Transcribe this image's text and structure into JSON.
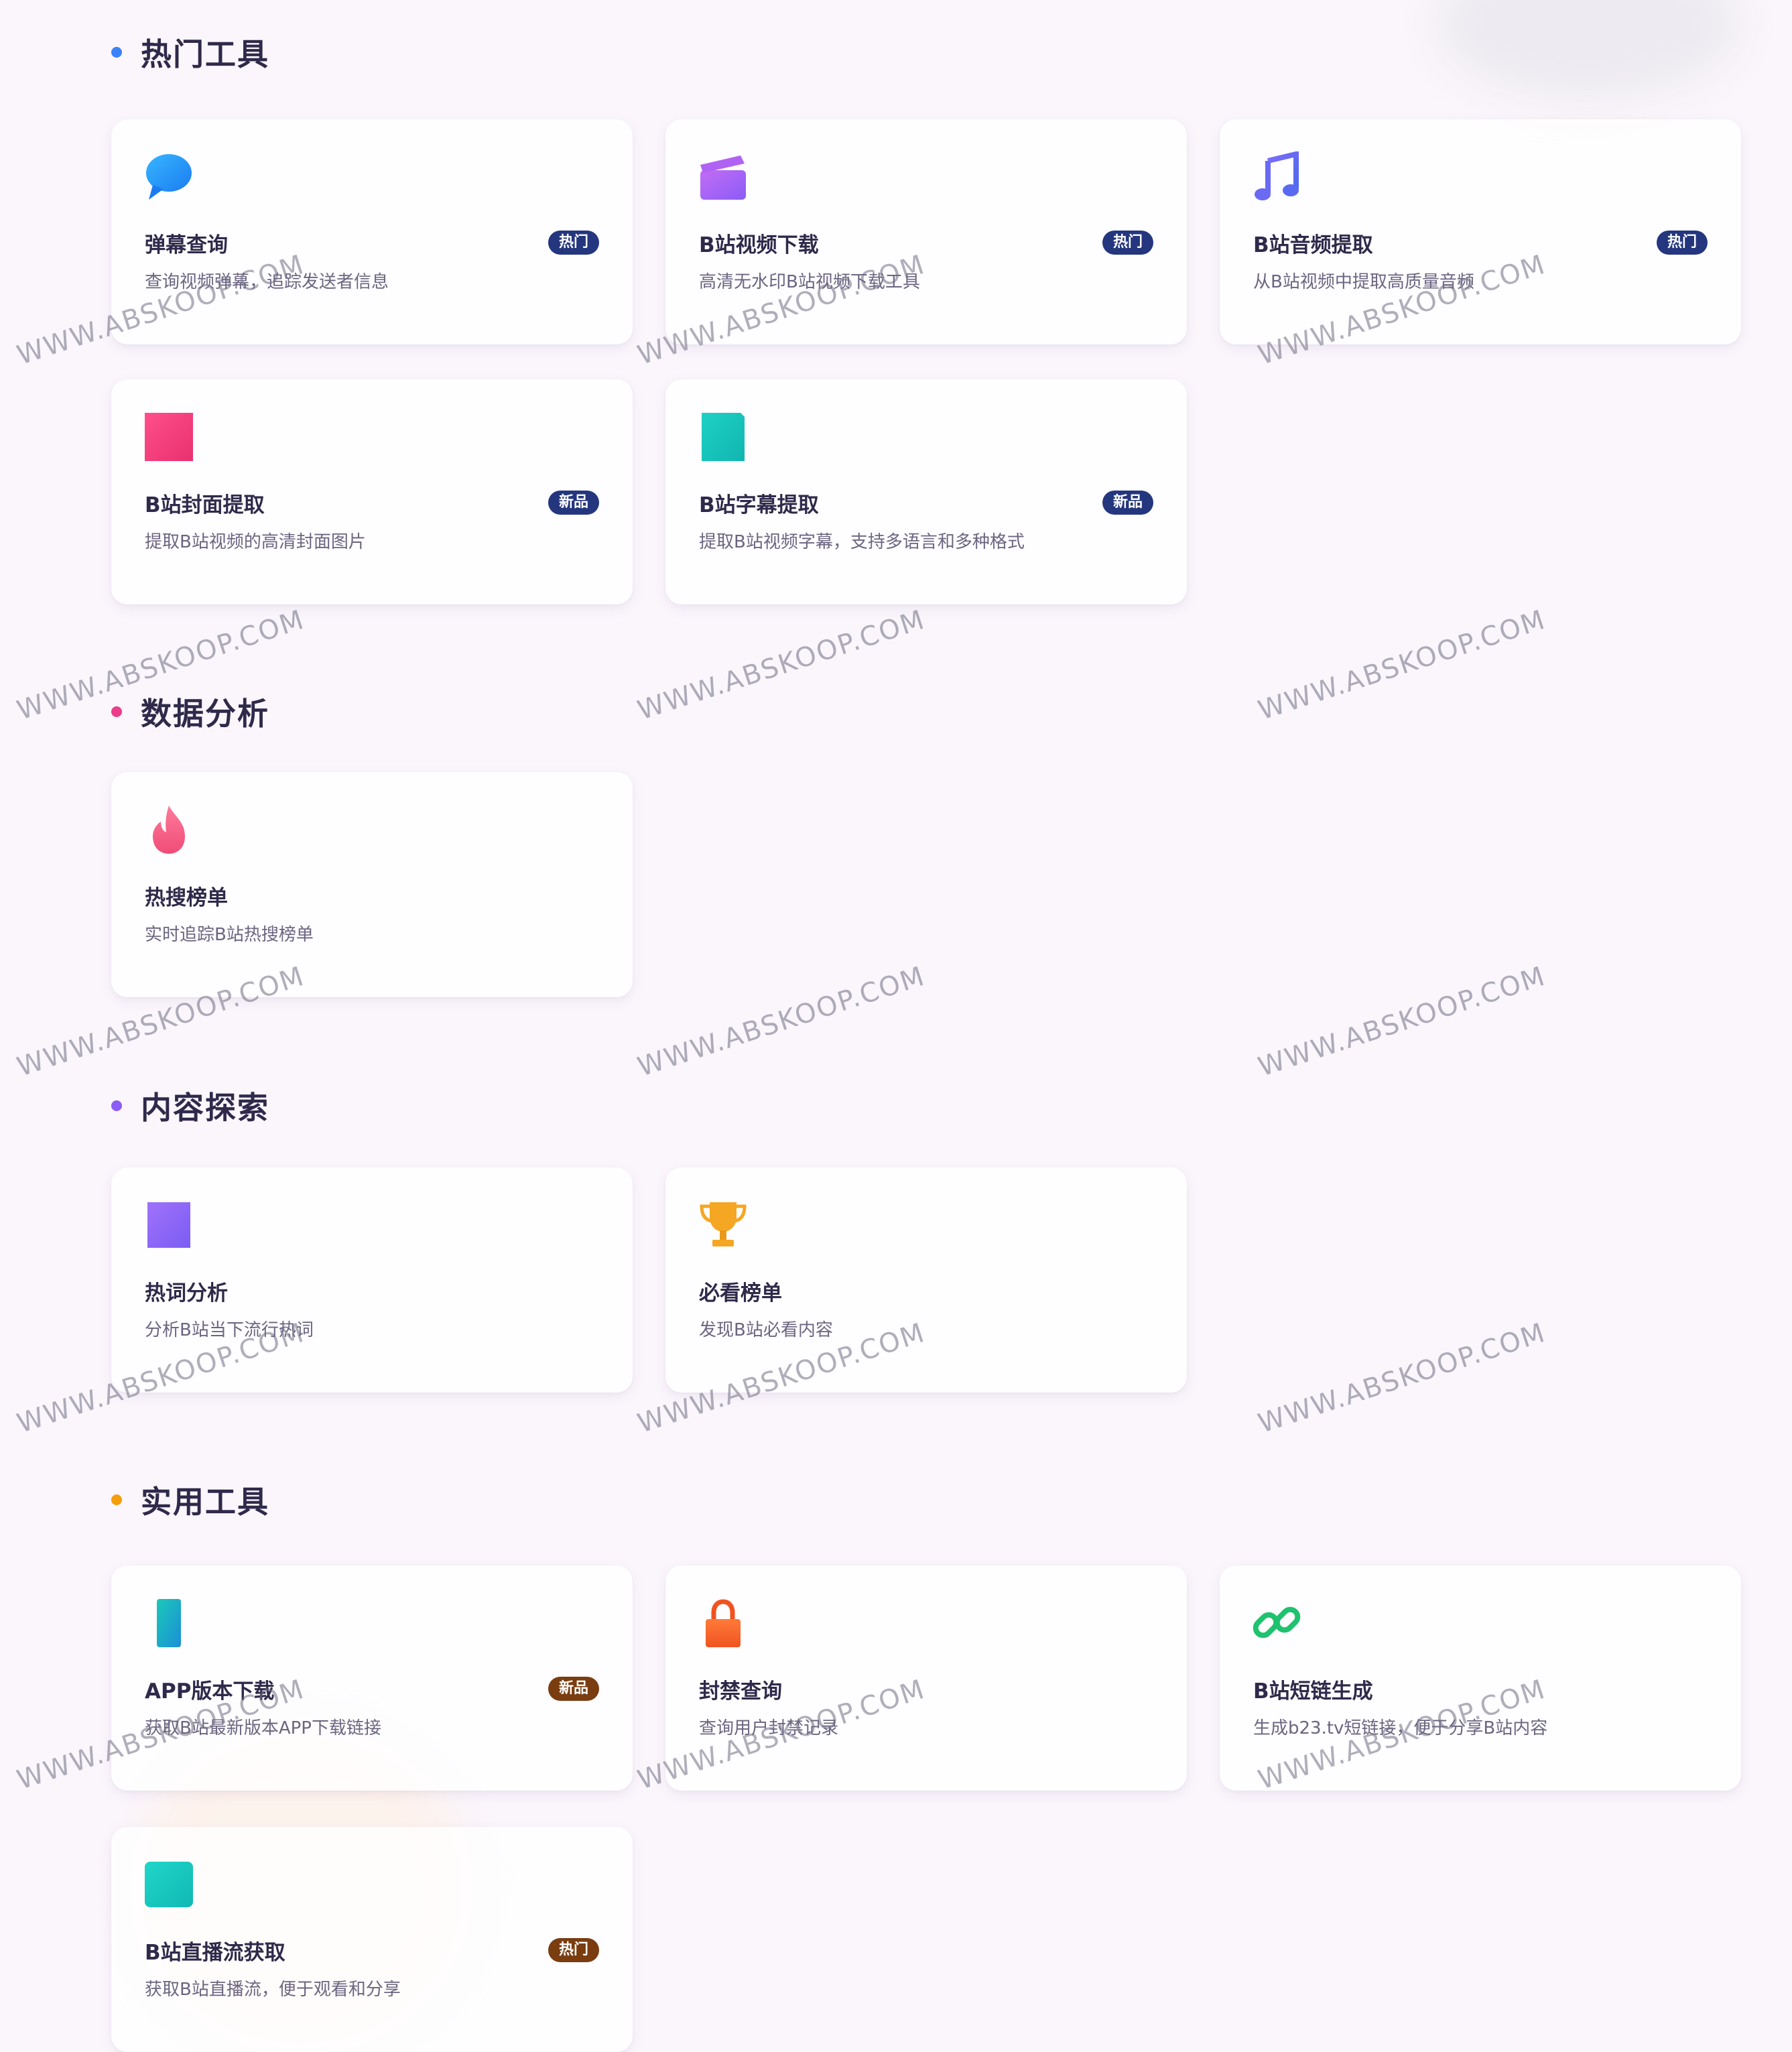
{
  "sections": [
    {
      "title": "热门工具",
      "dot_color": "#3a82f7",
      "cards": [
        {
          "title": "弹幕查询",
          "desc": "查询视频弹幕，追踪发送者信息",
          "badge": "热门",
          "icon": "speech-bubble-icon"
        },
        {
          "title": "B站视频下载",
          "desc": "高清无水印B站视频下载工具",
          "badge": "热门",
          "icon": "clapperboard-icon"
        },
        {
          "title": "B站音频提取",
          "desc": "从B站视频中提取高质量音频",
          "badge": "热门",
          "icon": "music-note-icon"
        },
        {
          "title": "B站封面提取",
          "desc": "提取B站视频的高清封面图片",
          "badge": "新品",
          "icon": "image-icon"
        },
        {
          "title": "B站字幕提取",
          "desc": "提取B站视频字幕，支持多语言和多种格式",
          "badge": "新品",
          "icon": "subtitle-icon"
        }
      ]
    },
    {
      "title": "数据分析",
      "dot_color": "#ec3d8a",
      "cards": [
        {
          "title": "热搜榜单",
          "desc": "实时追踪B站热搜榜单",
          "icon": "fire-icon"
        }
      ]
    },
    {
      "title": "内容探索",
      "dot_color": "#8b5cf6",
      "cards": [
        {
          "title": "热词分析",
          "desc": "分析B站当下流行热词",
          "icon": "chart-icon"
        },
        {
          "title": "必看榜单",
          "desc": "发现B站必看内容",
          "icon": "trophy-icon"
        }
      ]
    },
    {
      "title": "实用工具",
      "dot_color": "#f59e0b",
      "cards": [
        {
          "title": "APP版本下载",
          "desc": "获取B站最新版本APP下载链接",
          "badge": "新品",
          "icon": "phone-icon"
        },
        {
          "title": "封禁查询",
          "desc": "查询用户封禁记录",
          "icon": "lock-icon"
        },
        {
          "title": "B站短链生成",
          "desc": "生成b23.tv短链接，便于分享B站内容",
          "icon": "link-icon"
        },
        {
          "title": "B站直播流获取",
          "desc": "获取B站直播流，便于观看和分享",
          "badge": "热门",
          "icon": "live-icon"
        }
      ]
    }
  ],
  "watermark": "WWW.ABSKOOP.COM",
  "colors": {
    "badge_blue": "#24367e",
    "badge_brown": "#7a3d10"
  }
}
